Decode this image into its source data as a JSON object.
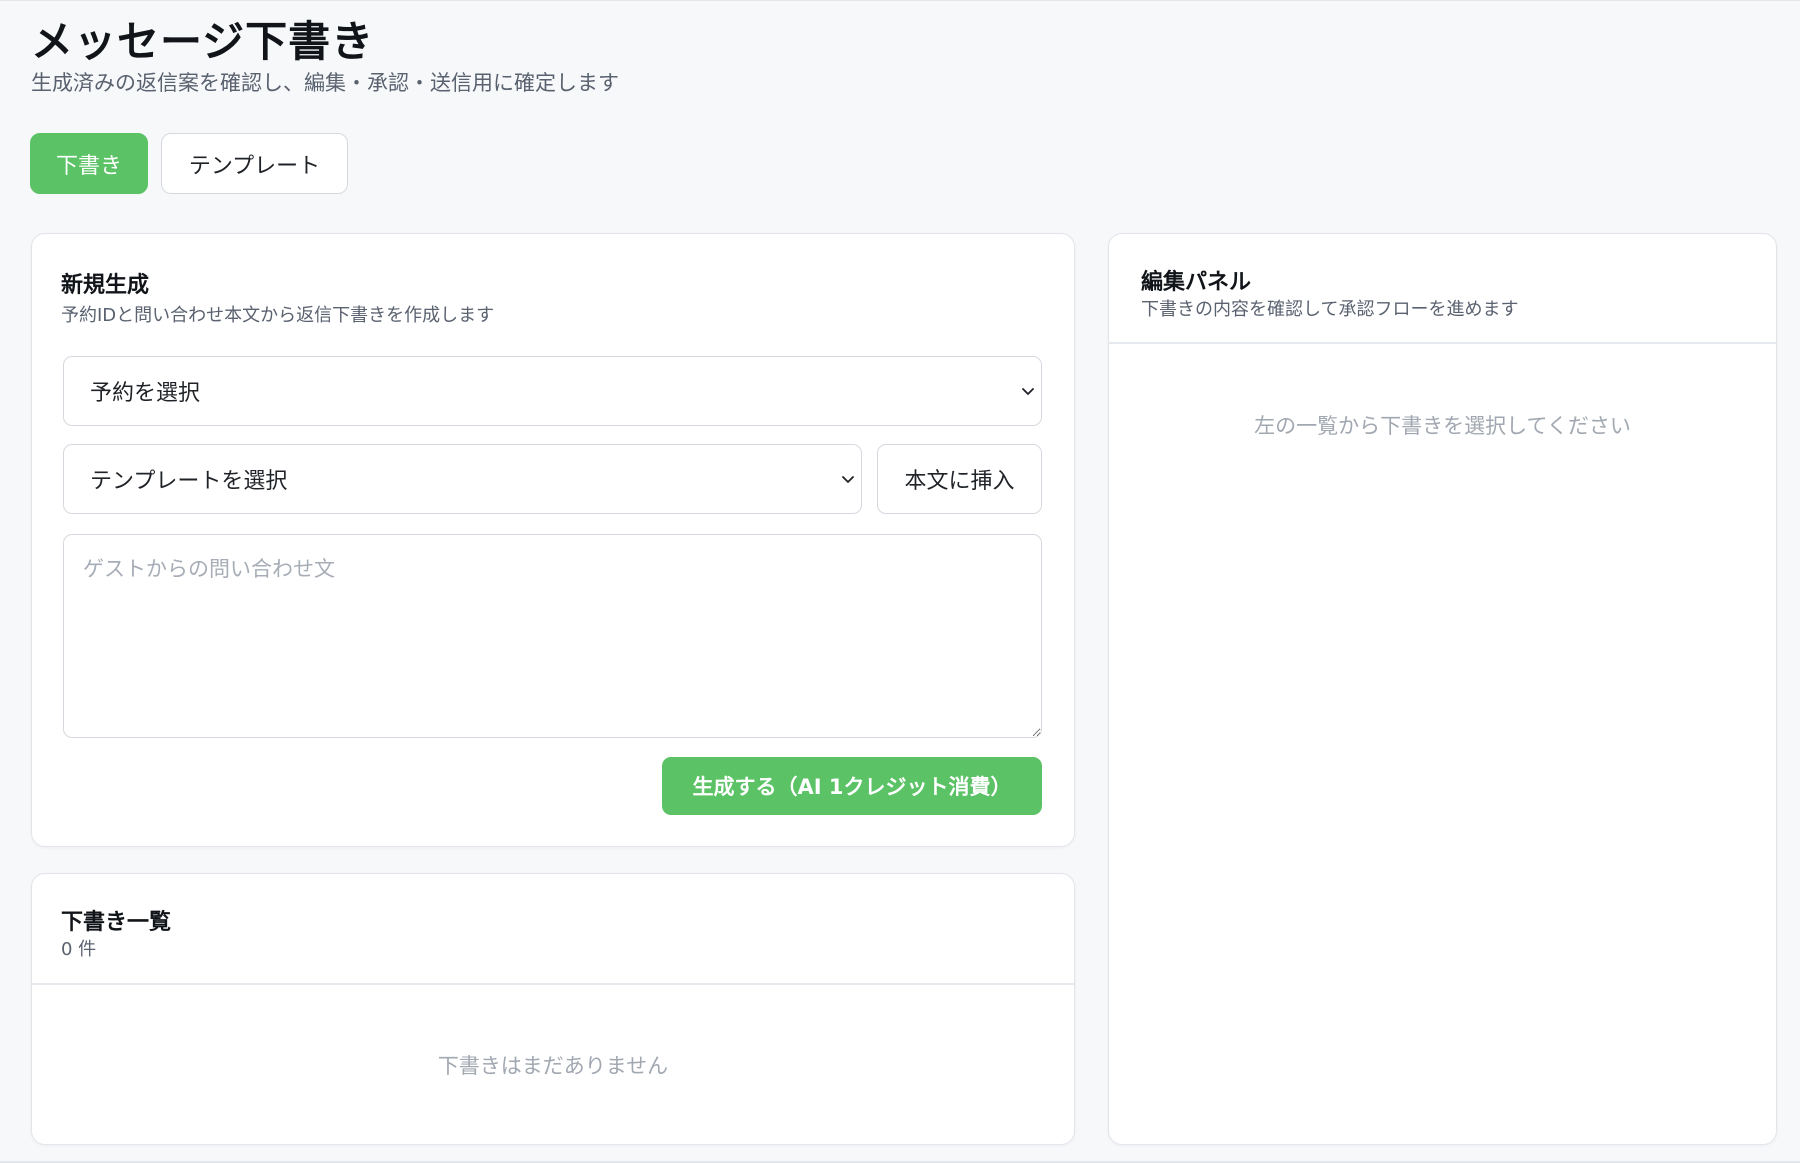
{
  "header": {
    "title": "メッセージ下書き",
    "subtitle": "生成済みの返信案を確認し、編集・承認・送信用に確定します"
  },
  "tabs": [
    {
      "label": "下書き",
      "active": true
    },
    {
      "label": "テンプレート",
      "active": false
    }
  ],
  "new_draft": {
    "title": "新規生成",
    "subtitle": "予約IDと問い合わせ本文から返信下書きを作成します",
    "reservation_select": {
      "value": "予約を選択"
    },
    "template_select": {
      "value": "テンプレートを選択"
    },
    "insert_label": "本文に挿入",
    "inquiry_placeholder": "ゲストからの問い合わせ文",
    "generate_label": "生成する（AI 1クレジット消費）"
  },
  "draft_list": {
    "title": "下書き一覧",
    "count": "0 件",
    "empty": "下書きはまだありません"
  },
  "edit_panel": {
    "title": "編集パネル",
    "subtitle": "下書きの内容を確認して承認フローを進めます",
    "empty": "左の一覧から下書きを選択してください"
  },
  "colors": {
    "accent": "#5bc266",
    "background": "#f7f8fa",
    "border": "#d5d9df",
    "muted_text": "#a2a8b1"
  },
  "icons": {
    "select_chevron": "chevron-down-icon",
    "textarea_resize": "resize-handle-icon"
  }
}
